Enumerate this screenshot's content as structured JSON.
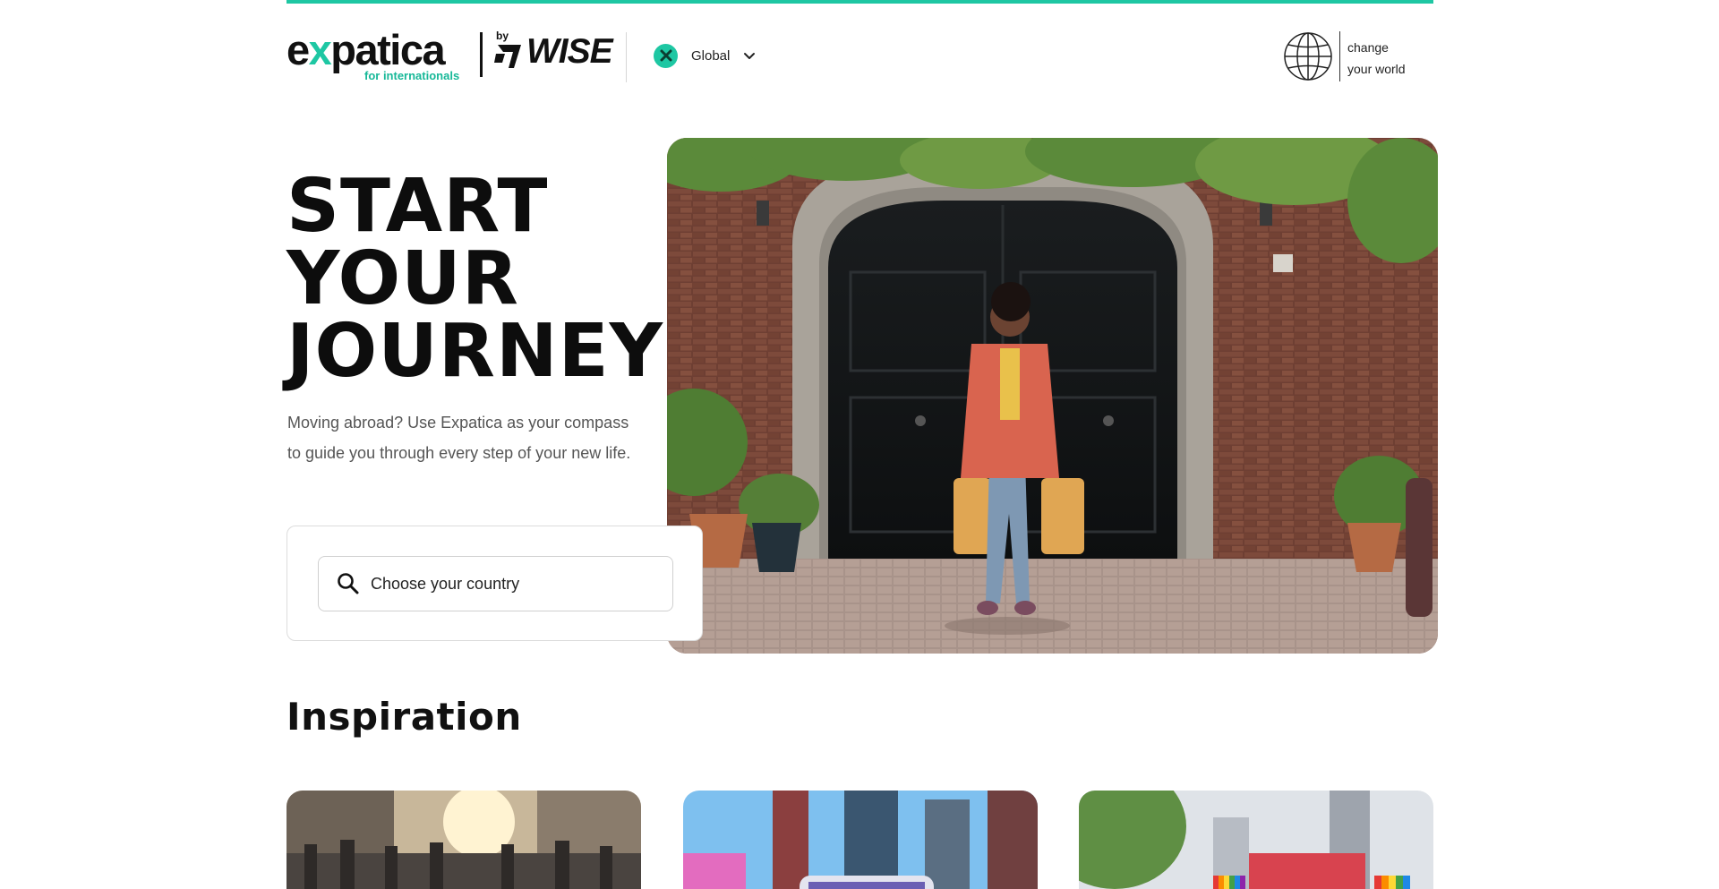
{
  "header": {
    "logo_word_start": "e",
    "logo_word_x": "x",
    "logo_word_end": "patica",
    "logo_tagline": "for internationals",
    "partner_by": "by",
    "partner_name": "WISE",
    "region": {
      "label": "Global",
      "icon": "region-x-icon"
    },
    "change_world_line1": "change",
    "change_world_line2": "your world"
  },
  "hero": {
    "title_line1": "START",
    "title_line2": "YOUR",
    "title_line3": "JOURNEY",
    "description": "Moving abroad? Use Expatica as your compass to guide you through every step of your new life.",
    "search_placeholder": "Choose your country"
  },
  "inspiration": {
    "title": "Inspiration"
  },
  "colors": {
    "accent": "#1ec7a3",
    "text": "#111111",
    "muted": "#555555"
  }
}
